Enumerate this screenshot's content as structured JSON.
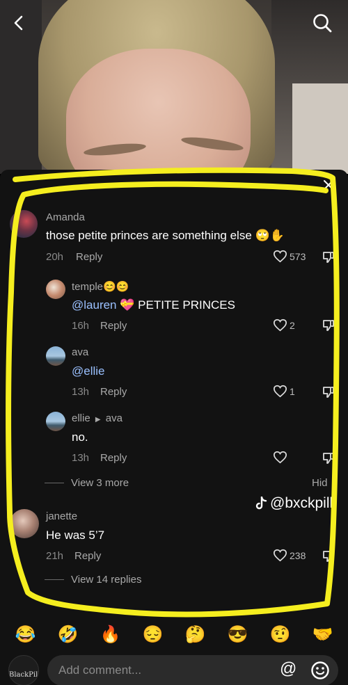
{
  "panel": {
    "comments": [
      {
        "username": "Amanda",
        "text": "those petite princes are something else 🙄✋",
        "time": "20h",
        "reply_label": "Reply",
        "likes": "573"
      },
      {
        "username": "temple😊😊",
        "mention": "@lauren",
        "text": "💝 PETITE PRINCES",
        "time": "16h",
        "reply_label": "Reply",
        "likes": "2"
      },
      {
        "username": "ava",
        "mention": "@ellie",
        "time": "13h",
        "reply_label": "Reply",
        "likes": "1"
      },
      {
        "username": "ellie",
        "reply_to": "ava",
        "text": "no.",
        "time": "13h",
        "reply_label": "Reply"
      },
      {
        "username": "janette",
        "text": "He was 5’7",
        "time": "21h",
        "reply_label": "Reply",
        "likes": "238"
      }
    ],
    "view_more": "View 3 more",
    "hide_label": "Hid",
    "view_replies": "View 14 replies",
    "watermark": "@bxckpill"
  },
  "emoji_bar": [
    "😂",
    "🤣",
    "🔥",
    "😔",
    "🤔",
    "😎",
    "🤨",
    "🤝"
  ],
  "input": {
    "placeholder": "Add comment...",
    "at_symbol": "@",
    "avatar_text": "BlackPill"
  },
  "colors": {
    "panel_bg": "#121212",
    "mention": "#9ac0ff",
    "highlight": "#f5ee1f"
  }
}
